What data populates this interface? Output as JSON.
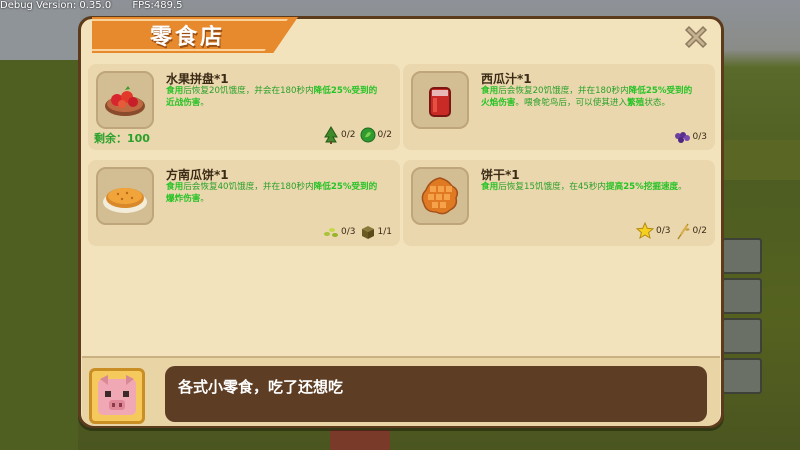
{
  "debug": {
    "version": "Debug Version: 0.35.0",
    "fps": "FPS:489.5"
  },
  "shop": {
    "title": "零食店",
    "close_icon": "close-x-icon",
    "remaining_label": "剩余：100"
  },
  "items": [
    {
      "name": "水果拼盘*1",
      "icon": "fruit-platter-icon",
      "desc_parts": [
        "食用",
        "后恢复20饥饿度，并会在180秒内",
        "降低25%受到的近战伤害",
        "。"
      ],
      "requirements": [
        {
          "icon": "sapling-icon",
          "count": "0/2"
        },
        {
          "icon": "leaf-coin-icon",
          "count": "0/2"
        }
      ]
    },
    {
      "name": "西瓜汁*1",
      "icon": "watermelon-juice-icon",
      "desc_parts": [
        "食用",
        "后会恢复20饥饿度，并在180秒内",
        "降低25%受到的火焰伤害",
        "。喂食鸵鸟后，可以使其进入",
        "繁殖",
        "状态。"
      ],
      "requirements": [
        {
          "icon": "grape-icon",
          "count": "0/3"
        }
      ]
    },
    {
      "name": "方南瓜饼*1",
      "icon": "pumpkin-pie-icon",
      "desc_parts": [
        "食用",
        "后会恢复40饥饿度，并在180秒内",
        "降低25%受到的爆炸伤害",
        "。"
      ],
      "requirements": [
        {
          "icon": "seeds-icon",
          "count": "0/3"
        },
        {
          "icon": "pumpkin-block-icon",
          "count": "1/1"
        }
      ]
    },
    {
      "name": "饼干*1",
      "icon": "waffle-cookie-icon",
      "desc_parts": [
        "食用",
        "后恢复15饥饿度，在45秒内",
        "提高25%挖掘速度",
        "。"
      ],
      "requirements": [
        {
          "icon": "star-icon",
          "count": "0/3"
        },
        {
          "icon": "wheat-icon",
          "count": "0/2"
        }
      ]
    }
  ],
  "npc": {
    "avatar_icon": "pig-avatar-icon",
    "speech": "各式小零食，吃了还想吃"
  }
}
